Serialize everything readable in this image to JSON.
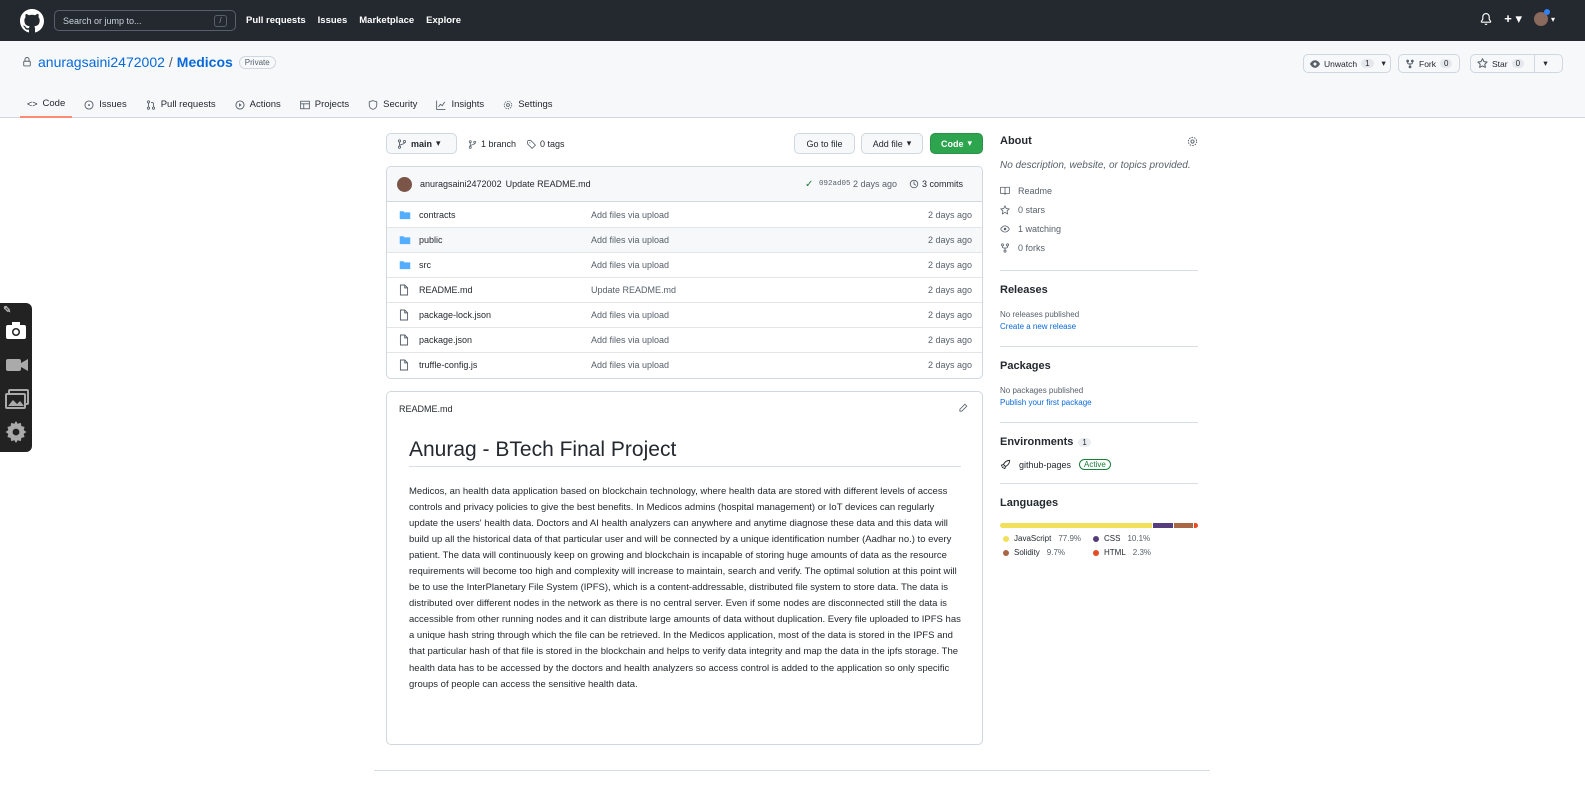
{
  "header": {
    "search_placeholder": "Search or jump to...",
    "search_shortcut": "/",
    "nav": [
      "Pull requests",
      "Issues",
      "Marketplace",
      "Explore"
    ]
  },
  "repo": {
    "owner": "anuragsaini2472002",
    "separator": "/",
    "name": "Medicos",
    "visibility": "Private",
    "unwatch_label": "Unwatch",
    "unwatch_count": "1",
    "fork_label": "Fork",
    "fork_count": "0",
    "star_label": "Star",
    "star_count": "0"
  },
  "tabs": [
    "Code",
    "Issues",
    "Pull requests",
    "Actions",
    "Projects",
    "Security",
    "Insights",
    "Settings"
  ],
  "toolbar": {
    "branch": "main",
    "branches": "1 branch",
    "tags": "0 tags",
    "go_to_file": "Go to file",
    "add_file": "Add file",
    "code": "Code"
  },
  "commit": {
    "author": "anuragsaini2472002",
    "message": "Update README.md",
    "sha": "092ad05",
    "age": "2 days ago",
    "commits": "3 commits"
  },
  "files": [
    {
      "type": "dir",
      "name": "contracts",
      "msg": "Add files via upload",
      "age": "2 days ago"
    },
    {
      "type": "dir",
      "name": "public",
      "msg": "Add files via upload",
      "age": "2 days ago"
    },
    {
      "type": "dir",
      "name": "src",
      "msg": "Add files via upload",
      "age": "2 days ago"
    },
    {
      "type": "file",
      "name": "README.md",
      "msg": "Update README.md",
      "age": "2 days ago"
    },
    {
      "type": "file",
      "name": "package-lock.json",
      "msg": "Add files via upload",
      "age": "2 days ago"
    },
    {
      "type": "file",
      "name": "package.json",
      "msg": "Add files via upload",
      "age": "2 days ago"
    },
    {
      "type": "file",
      "name": "truffle-config.js",
      "msg": "Add files via upload",
      "age": "2 days ago"
    }
  ],
  "readme": {
    "filename": "README.md",
    "title": "Anurag - BTech Final Project",
    "body": "Medicos, an health data application based on blockchain technology, where health data are stored with different levels of access controls and privacy policies to give the best benefits. In Medicos admins (hospital management) or IoT devices can regularly update the users' health data. Doctors and AI health analyzers can anywhere and anytime diagnose these data and this data will build up all the historical data of that particular user and will be connected by a unique identification number (Aadhar no.) to every patient. The data will continuously keep on growing and blockchain is incapable of storing huge amounts of data as the resource requirements will become too high and complexity will increase to maintain, search and verify. The optimal solution at this point will be to use the InterPlanetary File System (IPFS), which is a content-addressable, distributed file system to store data. The data is distributed over different nodes in the network as there is no central server. Even if some nodes are disconnected still the data is accessible from other running nodes and it can distribute large amounts of data without duplication. Every file uploaded to IPFS has a unique hash string through which the file can be retrieved. In the Medicos application, most of the data is stored in the IPFS and that particular hash of that file is stored in the blockchain and helps to verify data integrity and map the data in the ipfs storage. The health data has to be accessed by the doctors and health analyzers so access control is added to the application so only specific groups of people can access the sensitive health data."
  },
  "about": {
    "title": "About",
    "description": "No description, website, or topics provided.",
    "readme": "Readme",
    "stars": "0 stars",
    "watching": "1 watching",
    "forks": "0 forks"
  },
  "releases": {
    "title": "Releases",
    "none": "No releases published",
    "link": "Create a new release"
  },
  "packages": {
    "title": "Packages",
    "none": "No packages published",
    "link": "Publish your first package"
  },
  "environments": {
    "title": "Environments",
    "count": "1",
    "name": "github-pages",
    "status": "Active"
  },
  "languages": {
    "title": "Languages",
    "items": [
      {
        "name": "JavaScript",
        "pct": "77.9%",
        "value": 77.9,
        "color": "#f1e05a"
      },
      {
        "name": "CSS",
        "pct": "10.1%",
        "value": 10.1,
        "color": "#563d7c"
      },
      {
        "name": "Solidity",
        "pct": "9.7%",
        "value": 9.7,
        "color": "#AA6746"
      },
      {
        "name": "HTML",
        "pct": "2.3%",
        "value": 2.3,
        "color": "#e34c26"
      }
    ]
  },
  "colors": {
    "code_button": "#2da44e",
    "active_badge": "#1a7f37",
    "selected_tab": "#fd8c73",
    "link": "#0969da"
  }
}
